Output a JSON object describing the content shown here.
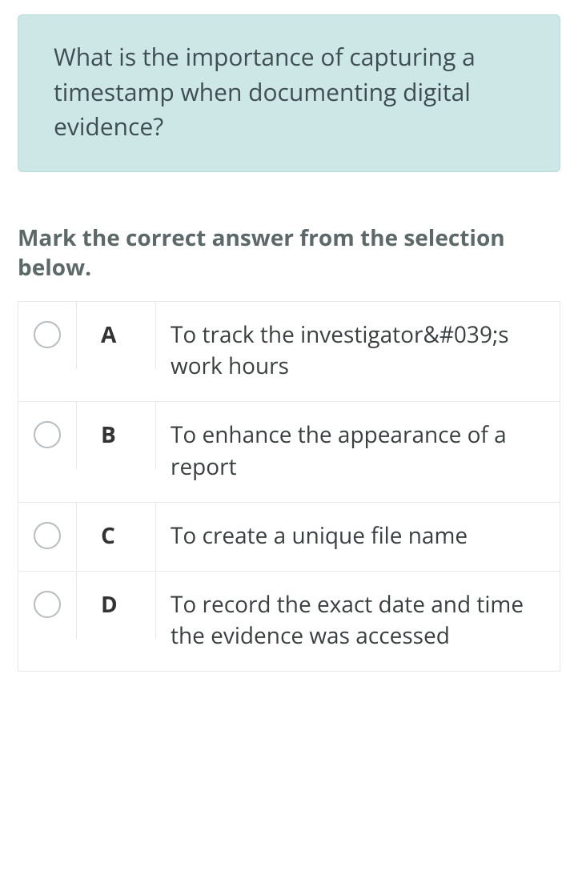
{
  "question": "What is the importance of capturing a timestamp when documenting digital evidence?",
  "instruction": "Mark the correct answer from the selection below.",
  "answers": [
    {
      "letter": "A",
      "text": "To track the investigator&#039;s work hours"
    },
    {
      "letter": "B",
      "text": "To enhance the appearance of a report"
    },
    {
      "letter": "C",
      "text": "To create a unique file name"
    },
    {
      "letter": "D",
      "text": "To record the exact date and time the evidence was accessed"
    }
  ]
}
